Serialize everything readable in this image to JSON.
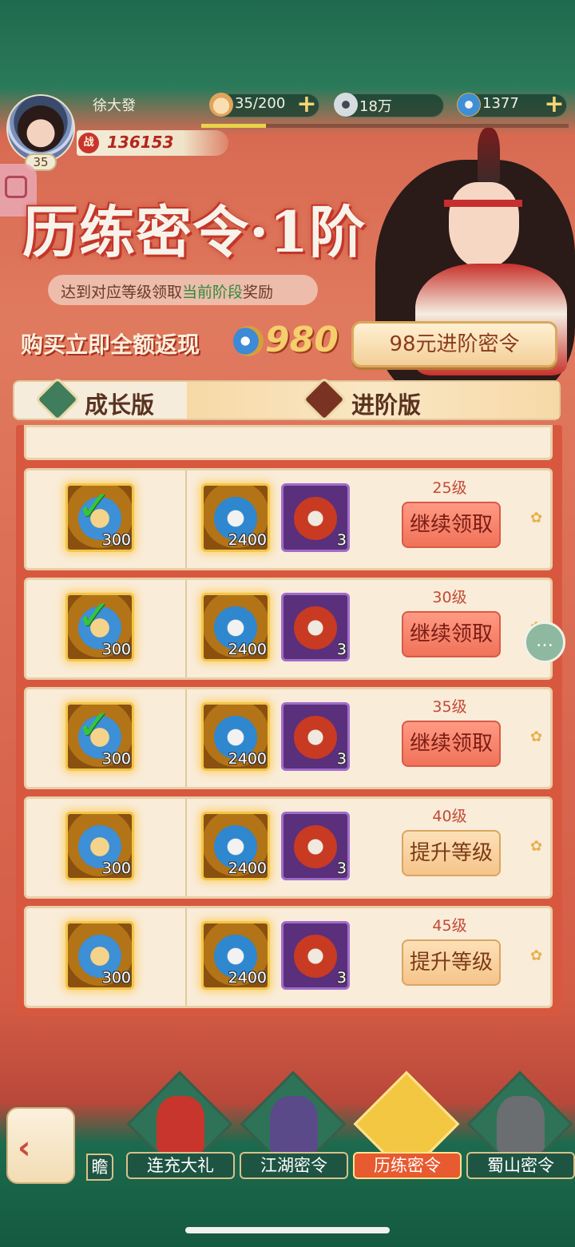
{
  "player": {
    "name": "徐大發",
    "level": "35",
    "power_icon": "战",
    "power": "136153"
  },
  "resources": {
    "stamina": "35/200",
    "stamina_fraction": 0.175,
    "coins": "18万",
    "jade": "1377"
  },
  "header": {
    "title": "历练密令·1阶",
    "subtitle_pre": "达到对应等级领取",
    "subtitle_highlight": "当前阶段",
    "subtitle_post": "奖励",
    "cashback_text": "购买立即全额返现",
    "cashback_amount": "980",
    "buy_button": "98元进阶密令"
  },
  "tabs": {
    "growth": "成长版",
    "advanced": "进阶版"
  },
  "rows": [
    {
      "level": "25级",
      "free_count": "300",
      "adv_count": "2400",
      "purple_count": "3",
      "free_claimed": true,
      "action": "继续领取",
      "action_type": "claim"
    },
    {
      "level": "30级",
      "free_count": "300",
      "adv_count": "2400",
      "purple_count": "3",
      "free_claimed": true,
      "action": "继续领取",
      "action_type": "claim"
    },
    {
      "level": "35级",
      "free_count": "300",
      "adv_count": "2400",
      "purple_count": "3",
      "free_claimed": true,
      "action": "继续领取",
      "action_type": "claim"
    },
    {
      "level": "40级",
      "free_count": "300",
      "adv_count": "2400",
      "purple_count": "3",
      "free_claimed": false,
      "action": "提升等级",
      "action_type": "upgrade"
    },
    {
      "level": "45级",
      "free_count": "300",
      "adv_count": "2400",
      "purple_count": "3",
      "free_claimed": false,
      "action": "提升等级",
      "action_type": "upgrade"
    }
  ],
  "bottom_nav": {
    "partial": "瞻",
    "items": [
      "连充大礼",
      "江湖密令",
      "历练密令",
      "蜀山密令"
    ],
    "active": "历练密令"
  },
  "icons": {
    "stamina": "bun-icon",
    "coins": "copper-coin-icon",
    "jade": "jade-ring-icon",
    "back": "back-arrow-icon",
    "chat": "chat-bubble-icon"
  },
  "colors": {
    "claim_button": "#f07259",
    "upgrade_button": "#f5c489",
    "highlight_text": "#2f8a3e",
    "level_text": "#c34a35"
  }
}
